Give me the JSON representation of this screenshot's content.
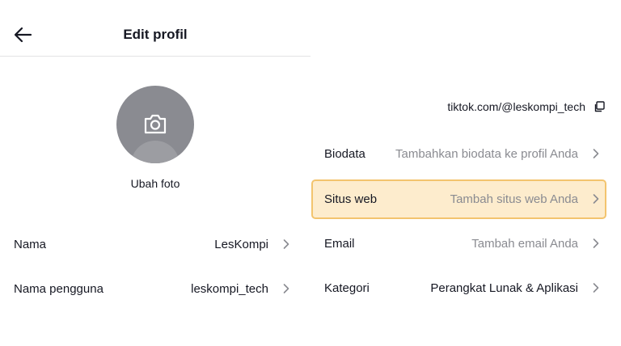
{
  "header": {
    "title": "Edit profil",
    "back_icon": "arrow-left-icon"
  },
  "profile": {
    "change_photo_label": "Ubah foto",
    "camera_icon": "camera-icon"
  },
  "fields_left": [
    {
      "label": "Nama",
      "value": "LesKompi"
    },
    {
      "label": "Nama pengguna",
      "value": "leskompi_tech"
    }
  ],
  "profile_url": {
    "text": "tiktok.com/@leskompi_tech",
    "icon": "copy-icon"
  },
  "fields_right": [
    {
      "label": "Biodata",
      "value": "Tambahkan biodata ke profil Anda",
      "placeholder": true
    },
    {
      "label": "Situs web",
      "value": "Tambah situs web Anda",
      "placeholder": true,
      "highlighted": true
    },
    {
      "label": "Email",
      "value": "Tambah email Anda",
      "placeholder": true
    },
    {
      "label": "Kategori",
      "value": "Perangkat Lunak & Aplikasi",
      "placeholder": false
    }
  ],
  "colors": {
    "highlight_fill": "#fdeccd",
    "highlight_border": "#f3c46e",
    "placeholder_text": "#8a8b91",
    "avatar_bg": "#8a8b91"
  }
}
